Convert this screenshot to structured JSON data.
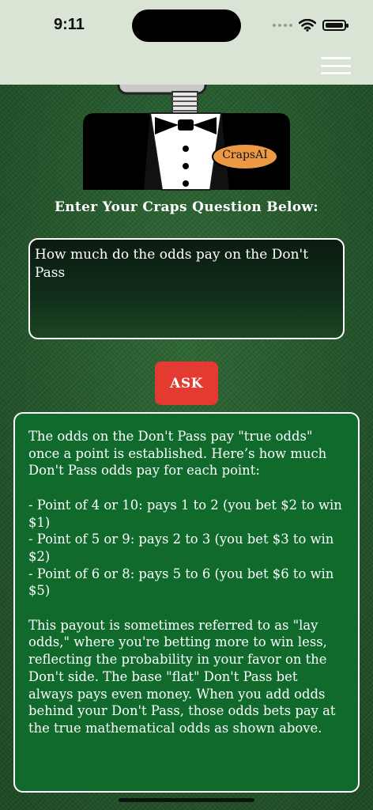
{
  "status_bar": {
    "time": "9:11"
  },
  "header": {
    "menu_icon": "hamburger-icon"
  },
  "mascot": {
    "badge_text": "CrapsAI",
    "badge_color": "#ee9a44"
  },
  "prompt": {
    "label": "Enter Your Craps Question Below:"
  },
  "question": {
    "value": "How much do the odds pay on the Don't Pass"
  },
  "ask_button": {
    "label": "ASK",
    "color": "#e33a32"
  },
  "answer": {
    "intro": "The odds on the Don't Pass pay \"true odds\" once a point is established. Here’s how much Don't Pass odds pay for each point:",
    "items": [
      "- Point of 4 or 10: pays 1 to 2 (you bet $2 to win $1)",
      "- Point of 5 or 9: pays 2 to 3 (you bet $3 to win $2)",
      "- Point of 6 or 8: pays 5 to 6 (you bet $6 to win $5)"
    ],
    "outro": "This payout is sometimes referred to as \"lay odds,\" where you're betting more to win less, reflecting the probability in your favor on the Don't side. The base \"flat\" Don't Pass bet always pays even money. When you add odds behind your Don't Pass, those odds bets pay at the true mathematical odds as shown above."
  }
}
